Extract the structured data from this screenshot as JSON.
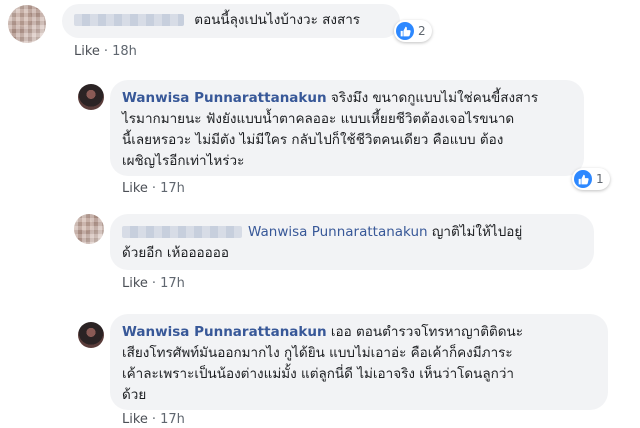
{
  "comments": [
    {
      "author": "",
      "text": "ตอนนี้ลุงเปนไงบ้างวะ สงสาร",
      "reaction_count": "2",
      "like_label": "Like",
      "time": "18h"
    },
    {
      "author": "Wanwisa Punnarattanakun",
      "text_lines": [
        "จริงมึง ขนาดกูแบบไม่ใช่คนขี้สงสาร",
        "ไรมากมายนะ ฟังยังแบบน้ำตาคลออะ แบบเหี้ยยชีวิตต้องเจอไรขนาด",
        "นี้เลยหรอวะ ไม่มีตัง ไม่มีใคร กลับไปก็ใช้ชีวิตคนเดียว คือแบบ ต้อง",
        "เผชิญไรอีกเท่าไหร่วะ"
      ],
      "reaction_count": "1",
      "like_label": "Like",
      "time": "17h"
    },
    {
      "author": "",
      "tag": "Wanwisa Punnarattanakun",
      "text_lines": [
        "ญาติไม่ให้ไปอยู่",
        "ด้วยอีก เห้ออออออ"
      ],
      "like_label": "Like",
      "time": "17h"
    },
    {
      "author": "Wanwisa Punnarattanakun",
      "text_lines": [
        "เออ ตอนตำรวจโทรหาญาติติดนะ",
        "เสียงโทรศัพท์มันออกมากไง กูได้ยิน แบบไม่เอาอ่ะ คือเค้าก็คงมีภาระ",
        "เค้าละเพราะเป็นน้องต่างแม่มั้ง แต่ลูกนี่ดี ไม่เอาจริง เห็นว่าโดนลูกว่า",
        "ด้วย"
      ],
      "like_label": "Like",
      "time": "17h"
    }
  ],
  "colors": {
    "name": "#385898",
    "bubble": "#f2f3f5",
    "like_icon": "#2d88ff"
  }
}
